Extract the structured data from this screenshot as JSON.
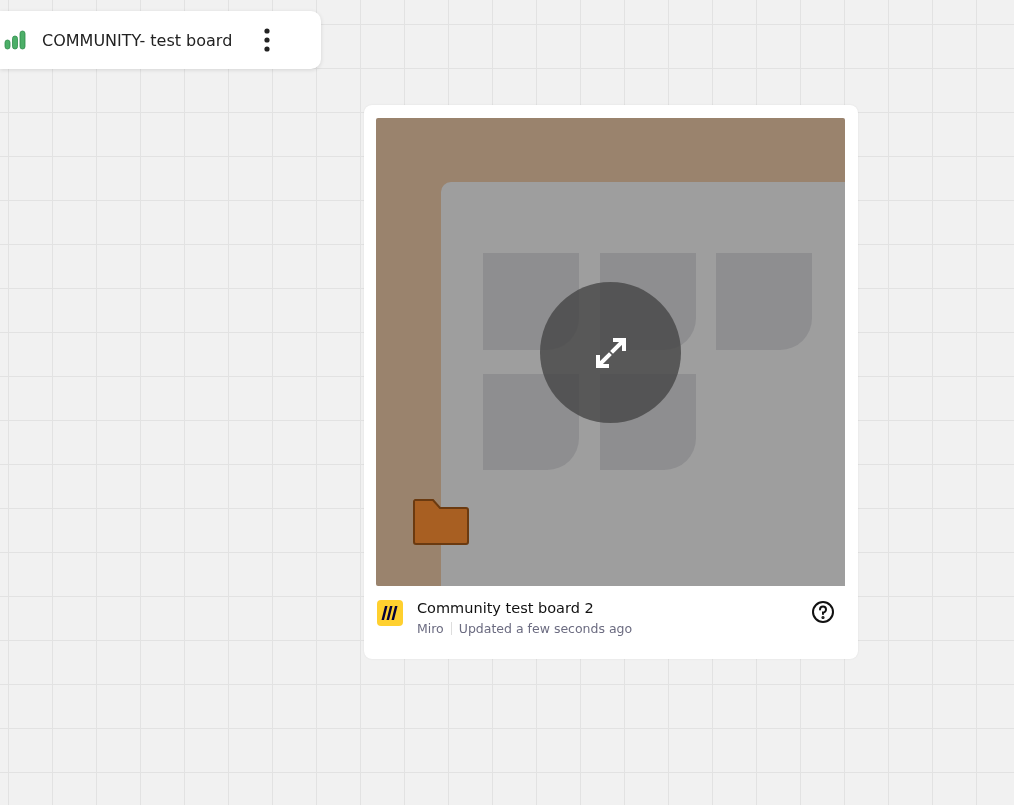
{
  "board_header": {
    "title": "COMMUNITY- test board"
  },
  "embed_card": {
    "title": "Community test board 2",
    "source": "Miro",
    "updated": "Updated a few seconds ago"
  }
}
